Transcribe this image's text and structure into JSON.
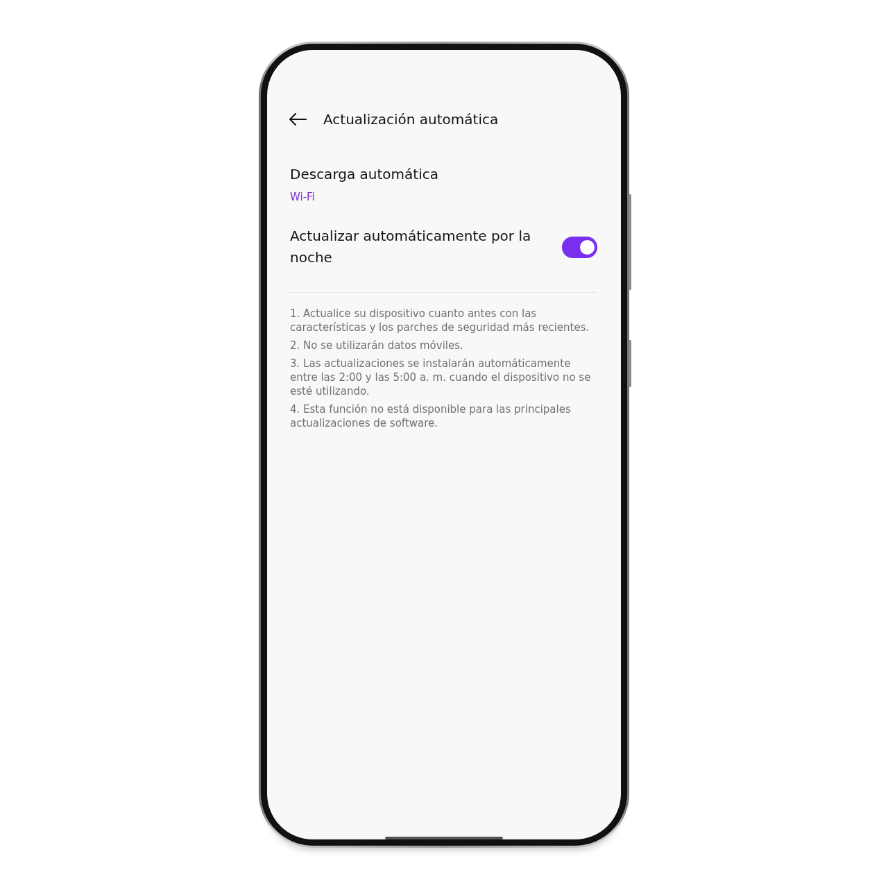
{
  "header": {
    "title": "Actualización automática"
  },
  "settings": [
    {
      "kind": "value",
      "title": "Descarga automática",
      "value": "Wi-Fi"
    },
    {
      "kind": "switch",
      "title": "Actualizar automáticamente por la noche",
      "on": true
    }
  ],
  "notes": [
    "1. Actualice su dispositivo cuanto antes con las características y los parches de seguridad más recientes.",
    "2. No se utilizarán datos móviles.",
    "3. Las actualizaciones se instalarán automáticamente entre las 2:00 y las 5:00 a. m. cuando el dispositivo no se esté utilizando.",
    "4. Esta función no está disponible para las principales actualizaciones de software."
  ]
}
